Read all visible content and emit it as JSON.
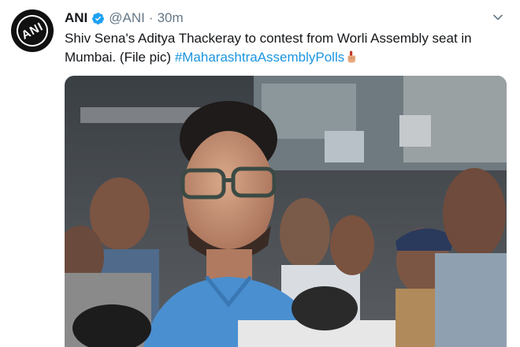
{
  "tweet": {
    "display_name": "ANI",
    "handle": "@ANI",
    "separator": "·",
    "time": "30m",
    "text_main": "Shiv Sena's Aditya Thackeray to contest from Worli Assembly seat in Mumbai. (File pic) ",
    "hashtag": "#MaharashtraAssemblyPolls",
    "avatar_logo_text": "ANI",
    "verified": true,
    "colors": {
      "name": "#14171a",
      "secondary": "#657786",
      "link": "#1b95e0",
      "verified": "#1da1f2"
    },
    "icons": [
      "verified-icon",
      "caret-down-icon",
      "raised-finger-icon"
    ]
  },
  "media": {
    "description_icon": "photo-icon"
  }
}
